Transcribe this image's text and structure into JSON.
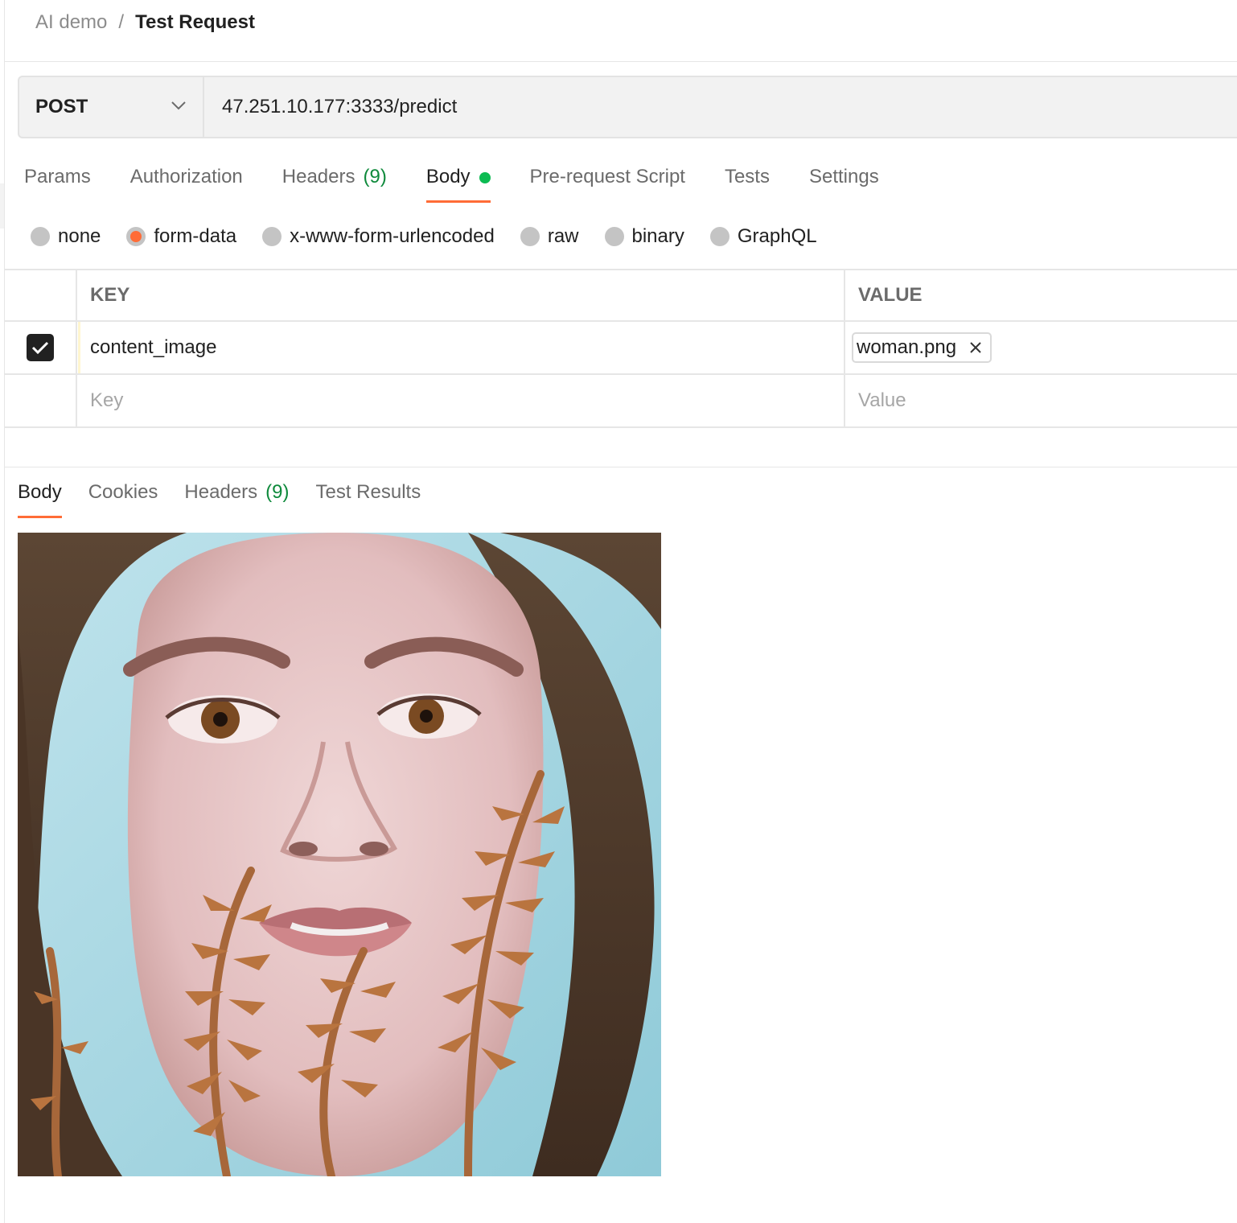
{
  "breadcrumb": {
    "collection": "AI demo",
    "separator": "/",
    "request": "Test Request"
  },
  "request": {
    "method": "POST",
    "url": "47.251.10.177:3333/predict"
  },
  "tabs": {
    "params": "Params",
    "authorization": "Authorization",
    "headers": "Headers",
    "headers_count": "(9)",
    "body": "Body",
    "prerequest": "Pre-request Script",
    "tests": "Tests",
    "settings": "Settings"
  },
  "body_types": [
    {
      "label": "none",
      "selected": false
    },
    {
      "label": "form-data",
      "selected": true
    },
    {
      "label": "x-www-form-urlencoded",
      "selected": false
    },
    {
      "label": "raw",
      "selected": false
    },
    {
      "label": "binary",
      "selected": false
    },
    {
      "label": "GraphQL",
      "selected": false
    }
  ],
  "form_table": {
    "headers": {
      "key": "KEY",
      "value": "VALUE"
    },
    "rows": [
      {
        "checked": true,
        "key": "content_image",
        "file": "woman.png"
      }
    ],
    "new_row": {
      "key_placeholder": "Key",
      "value_placeholder": "Value"
    }
  },
  "response_tabs": {
    "body": "Body",
    "cookies": "Cookies",
    "headers": "Headers",
    "headers_count": "(9)",
    "test_results": "Test Results"
  },
  "colors": {
    "accent": "#ff6c37",
    "count_green": "#0f8a3c",
    "dot_green": "#0cbb52"
  }
}
